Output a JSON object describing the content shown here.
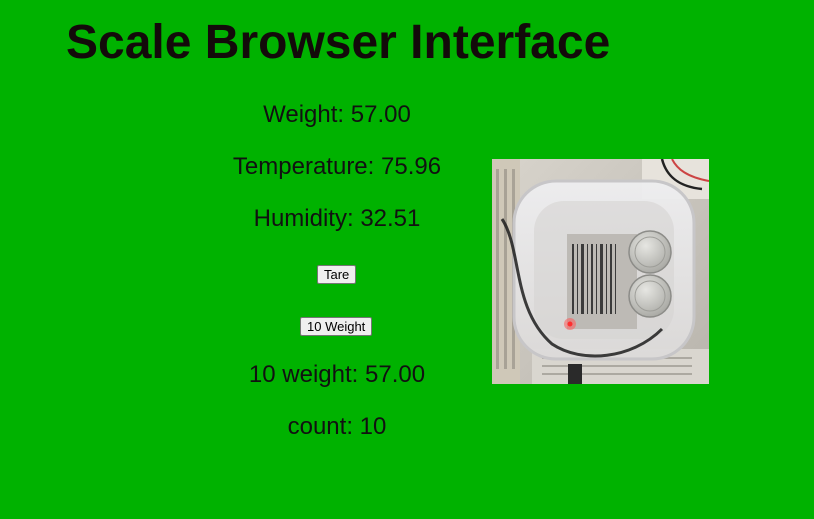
{
  "page": {
    "title": "Scale Browser Interface"
  },
  "readings": {
    "weight": {
      "label": "Weight:",
      "value": "57.00"
    },
    "temperature": {
      "label": "Temperature:",
      "value": "75.96"
    },
    "humidity": {
      "label": "Humidity:",
      "value": "32.51"
    },
    "ten_weight": {
      "label": "10 weight:",
      "value": "57.00"
    },
    "count": {
      "label": "count:",
      "value": "10"
    }
  },
  "buttons": {
    "tare": "Tare",
    "ten_weight": "10 Weight"
  },
  "colors": {
    "background": "#00b200",
    "title": "#130a0a"
  },
  "image": {
    "alt": "scale-camera-photo"
  }
}
